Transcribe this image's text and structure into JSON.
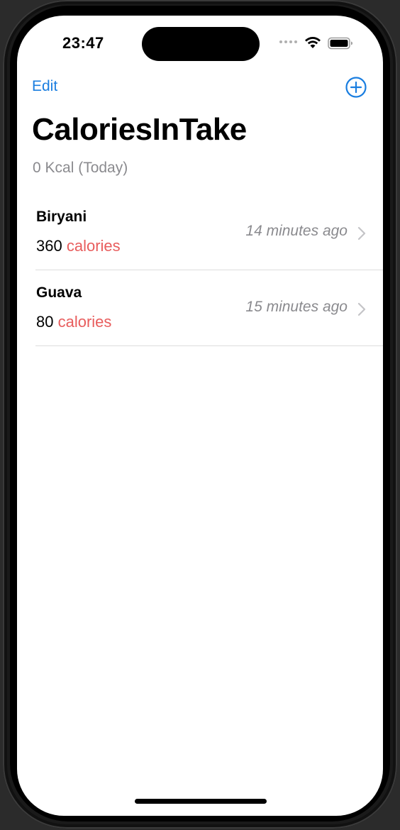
{
  "status_bar": {
    "time": "23:47",
    "icons": [
      "signal-dots-icon",
      "wifi-icon",
      "battery-icon"
    ]
  },
  "nav": {
    "edit_label": "Edit",
    "add_icon": "plus-circle-icon"
  },
  "header": {
    "title": "CaloriesInTake",
    "subtitle": "0 Kcal (Today)"
  },
  "entries": [
    {
      "name": "Biryani",
      "calories": "360",
      "unit": "calories",
      "time": "14 minutes ago"
    },
    {
      "name": "Guava",
      "calories": "80",
      "unit": "calories",
      "time": "15 minutes ago"
    }
  ],
  "colors": {
    "accent": "#1a7ee0",
    "calories": "#e85d5d",
    "secondary_text": "#8a8a8e"
  }
}
